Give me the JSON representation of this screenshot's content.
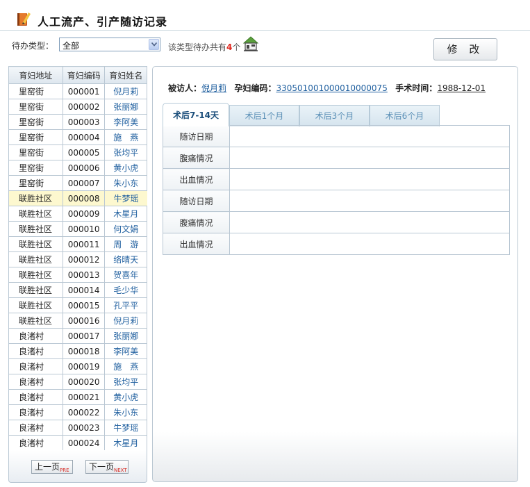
{
  "header": {
    "title": "人工流产、引产随访记录",
    "icon": "notebook-pencil-icon"
  },
  "filter": {
    "label": "待办类型：",
    "selected": "全部",
    "count_prefix": "该类型待办共有",
    "count": "4",
    "count_suffix": "个"
  },
  "toolbar": {
    "edit_label": "修 改"
  },
  "list": {
    "headers": [
      "育妇地址",
      "育妇编码",
      "育妇姓名"
    ],
    "selected_index": 7,
    "rows": [
      {
        "addr": "里窑街",
        "code": "000001",
        "name": "倪月莉"
      },
      {
        "addr": "里窑街",
        "code": "000002",
        "name": "张丽娜"
      },
      {
        "addr": "里窑街",
        "code": "000003",
        "name": "李阿美"
      },
      {
        "addr": "里窑街",
        "code": "000004",
        "name": "施　燕"
      },
      {
        "addr": "里窑街",
        "code": "000005",
        "name": "张均平"
      },
      {
        "addr": "里窑街",
        "code": "000006",
        "name": "黄小虎"
      },
      {
        "addr": "里窑街",
        "code": "000007",
        "name": "朱小东"
      },
      {
        "addr": "联胜社区",
        "code": "000008",
        "name": "牛梦瑶"
      },
      {
        "addr": "联胜社区",
        "code": "000009",
        "name": "木星月"
      },
      {
        "addr": "联胜社区",
        "code": "000010",
        "name": "何文娟"
      },
      {
        "addr": "联胜社区",
        "code": "000011",
        "name": "周　游"
      },
      {
        "addr": "联胜社区",
        "code": "000012",
        "name": "络晴天"
      },
      {
        "addr": "联胜社区",
        "code": "000013",
        "name": "贺喜年"
      },
      {
        "addr": "联胜社区",
        "code": "000014",
        "name": "毛少华"
      },
      {
        "addr": "联胜社区",
        "code": "000015",
        "name": "孔平平"
      },
      {
        "addr": "联胜社区",
        "code": "000016",
        "name": "倪月莉"
      },
      {
        "addr": "良渚村",
        "code": "000017",
        "name": "张丽娜"
      },
      {
        "addr": "良渚村",
        "code": "000018",
        "name": "李阿美"
      },
      {
        "addr": "良渚村",
        "code": "000019",
        "name": "施　燕"
      },
      {
        "addr": "良渚村",
        "code": "000020",
        "name": "张均平"
      },
      {
        "addr": "良渚村",
        "code": "000021",
        "name": "黄小虎"
      },
      {
        "addr": "良渚村",
        "code": "000022",
        "name": "朱小东"
      },
      {
        "addr": "良渚村",
        "code": "000023",
        "name": "牛梦瑶"
      },
      {
        "addr": "良渚村",
        "code": "000024",
        "name": "木星月"
      }
    ]
  },
  "pager": {
    "prev": "上一页",
    "prev_tag": "PRE",
    "next": "下一页",
    "next_tag": "NEXT"
  },
  "detail": {
    "visitee_label": "被访人：",
    "visitee": "倪月莉",
    "code_label": "孕妇编码：",
    "code": "330501001000010000075",
    "date_label": "手术时间：",
    "date": "1988-12-01",
    "tabs": [
      "术后7-14天",
      "术后1个月",
      "术后3个月",
      "术后6个月"
    ],
    "rows": [
      "随访日期",
      "腹痛情况",
      "出血情况",
      "随访日期",
      "腹痛情况",
      "出血情况"
    ]
  },
  "colors": {
    "accent": "#1f5f9f",
    "count": "#e0281f",
    "selected_row": "#fdf8cf"
  }
}
